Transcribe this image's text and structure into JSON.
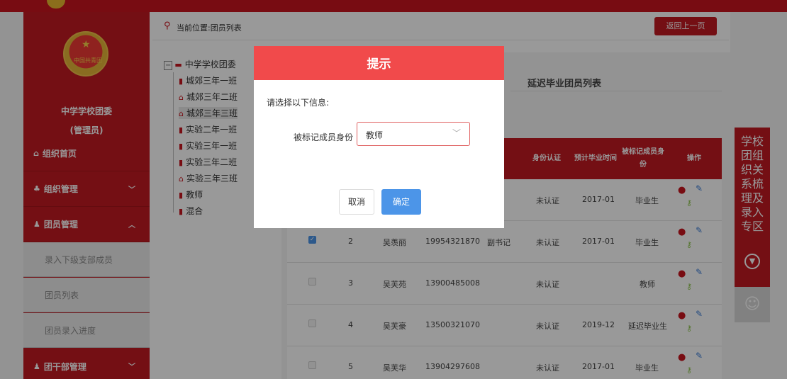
{
  "breadcrumb": {
    "label": "当前位置:团员列表"
  },
  "back_button": "返回上一页",
  "sidebar": {
    "org_name": "中学学校团委",
    "role": "(管理员)",
    "emblem_text": "中国共青团",
    "items": [
      {
        "label": "组织首页",
        "icon": "home-icon"
      },
      {
        "label": "组织管理",
        "icon": "org-icon",
        "chevron": "﹀"
      },
      {
        "label": "团员管理",
        "icon": "member-icon",
        "chevron": "︿"
      },
      {
        "label": "团干部管理",
        "icon": "cadre-icon",
        "chevron": "﹀"
      }
    ],
    "sub_items": [
      {
        "label": "录入下级支部成员"
      },
      {
        "label": "团员列表"
      },
      {
        "label": "团员录入进度"
      }
    ]
  },
  "tree": {
    "root": "中学学校团委",
    "nodes": [
      {
        "label": "城郊三年一班"
      },
      {
        "label": "城郊三年二班"
      },
      {
        "label": "城郊三年三班"
      },
      {
        "label": "实验二年一班"
      },
      {
        "label": "实验三年一班"
      },
      {
        "label": "实验三年二班"
      },
      {
        "label": "实验三年三班"
      },
      {
        "label": "教师"
      },
      {
        "label": "混合"
      }
    ]
  },
  "panel": {
    "title": "延迟毕业团员列表",
    "headers": {
      "auth": "身份认证",
      "grad": "预计毕业时间",
      "marked": "被标记成员身份",
      "ops": "操作"
    },
    "rows": [
      {
        "checked": true,
        "no": "2",
        "name": "吴羡丽",
        "phone": "19954321870",
        "duty": "副书记",
        "auth": "未认证",
        "grad": "2017-01",
        "marked": "毕业生"
      },
      {
        "checked": false,
        "no": "3",
        "name": "吴芙苑",
        "phone": "13900485008",
        "duty": "",
        "auth": "未认证",
        "grad": "",
        "marked": "教师"
      },
      {
        "checked": false,
        "no": "4",
        "name": "吴芙豪",
        "phone": "13500321070",
        "duty": "",
        "auth": "未认证",
        "grad": "2019-12",
        "marked": "延迟毕业生"
      },
      {
        "checked": false,
        "no": "5",
        "name": "吴芙华",
        "phone": "13904297608",
        "duty": "",
        "auth": "未认证",
        "grad": "2017-01",
        "marked": "毕业生"
      }
    ],
    "partial_row": {
      "auth": "未认证",
      "grad": "2017-01",
      "marked": "毕业生"
    }
  },
  "side_tab": {
    "text": "学校团组织关系梳理及录入专区"
  },
  "modal": {
    "title": "提示",
    "prompt": "请选择以下信息:",
    "field_label": "被标记成员身份",
    "select_value": "教师",
    "cancel": "取消",
    "confirm": "确定"
  },
  "colors": {
    "brand_red": "#c21a22",
    "modal_header": "#f14a4b",
    "confirm_blue": "#4c95e8"
  }
}
